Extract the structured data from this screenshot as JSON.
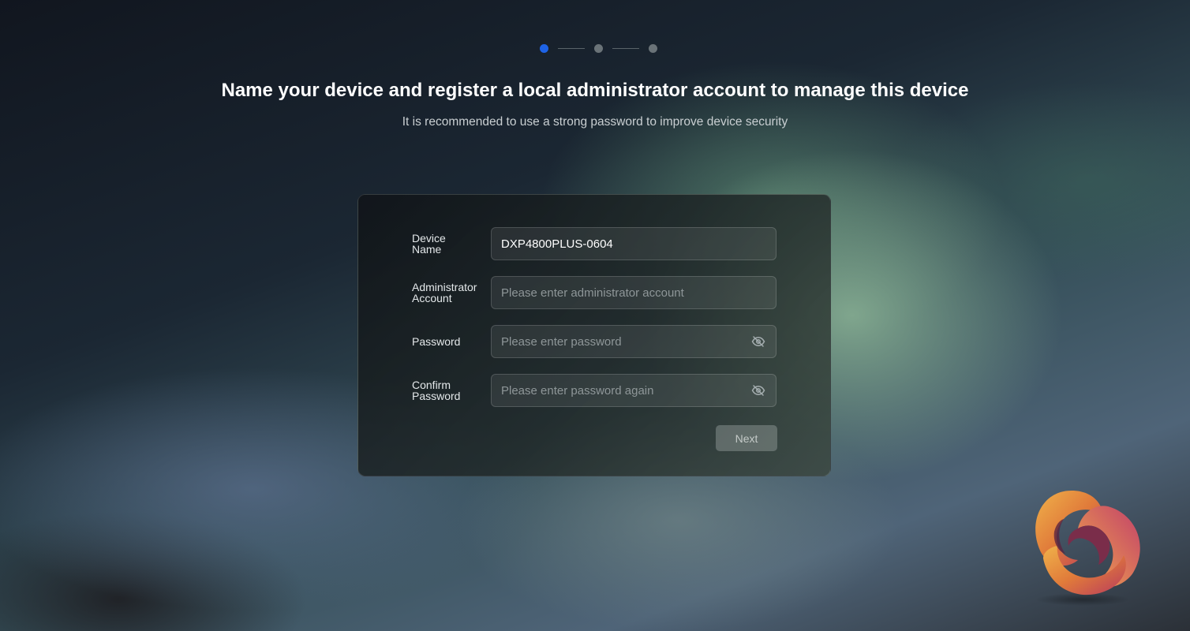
{
  "stepper": {
    "total_steps": 3,
    "current_step": 1,
    "active_color": "#1e63e6"
  },
  "header": {
    "title": "Name your device and register a local administrator account to manage this device",
    "subtitle": "It is recommended to use a strong password to improve device security"
  },
  "form": {
    "device_name": {
      "label_line1": "Device",
      "label_line2": "Name",
      "value": "DXP4800PLUS-0604"
    },
    "admin_account": {
      "label_line1": "Administrator",
      "label_line2": "Account",
      "placeholder": "Please enter administrator account"
    },
    "password": {
      "label": "Password",
      "placeholder": "Please enter password",
      "icon": "eye-off-icon"
    },
    "confirm_password": {
      "label_line1": "Confirm",
      "label_line2": "Password",
      "placeholder": "Please enter password again",
      "icon": "eye-off-icon"
    },
    "next_label": "Next"
  },
  "logo": {
    "name": "app-logo"
  }
}
